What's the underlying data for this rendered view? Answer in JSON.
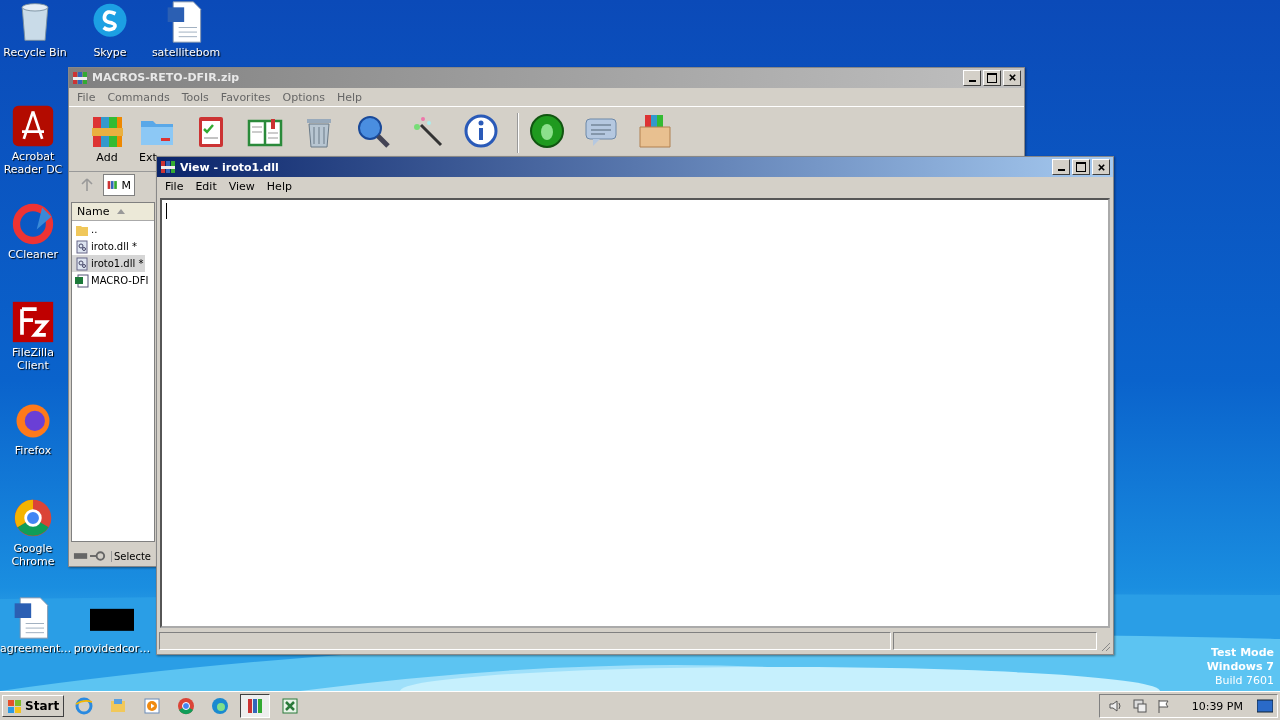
{
  "desktop_icons": [
    {
      "label": "Recycle Bin",
      "kind": "recycle"
    },
    {
      "label": "Skype",
      "kind": "skype"
    },
    {
      "label": "satellitebom",
      "kind": "word"
    },
    {
      "label": "Acrobat Reader DC",
      "kind": "acrobat"
    },
    {
      "label": "CCleaner",
      "kind": "ccleaner"
    },
    {
      "label": "FileZilla Client",
      "kind": "filezilla"
    },
    {
      "label": "Firefox",
      "kind": "firefox"
    },
    {
      "label": "Google Chrome",
      "kind": "chrome"
    },
    {
      "label": "agreement…",
      "kind": "word"
    },
    {
      "label": "providedcor…",
      "kind": "black"
    }
  ],
  "archiver": {
    "title": "MACROS-RETO-DFIR.zip",
    "menu": [
      "File",
      "Commands",
      "Tools",
      "Favorites",
      "Options",
      "Help"
    ],
    "toolbar": [
      {
        "kind": "add",
        "label": "Add"
      },
      {
        "kind": "extract",
        "label": "Ext"
      },
      {
        "kind": "test"
      },
      {
        "kind": "view"
      },
      {
        "kind": "delete"
      },
      {
        "kind": "find"
      },
      {
        "kind": "wizard"
      },
      {
        "kind": "info"
      },
      {
        "kind": "scan"
      },
      {
        "kind": "comment"
      },
      {
        "kind": "sfx"
      }
    ],
    "path": "M",
    "column": "Name",
    "files": [
      {
        "name": "..",
        "kind": "folder",
        "selected": false
      },
      {
        "name": "iroto.dll *",
        "kind": "dll",
        "selected": false
      },
      {
        "name": "iroto1.dll *",
        "kind": "dll",
        "selected": true
      },
      {
        "name": "MACRO-DFI",
        "kind": "excel",
        "selected": false
      }
    ],
    "status": "Selecte"
  },
  "viewer": {
    "title": "View - iroto1.dll",
    "menu": [
      "File",
      "Edit",
      "View",
      "Help"
    ]
  },
  "taskbar": {
    "start": "Start",
    "apps": [
      {
        "kind": "ie",
        "selected": false
      },
      {
        "kind": "explorer",
        "selected": false
      },
      {
        "kind": "media",
        "selected": false
      },
      {
        "kind": "chrome",
        "selected": false
      },
      {
        "kind": "edge",
        "selected": false
      },
      {
        "kind": "winrar",
        "selected": true
      },
      {
        "kind": "excel",
        "selected": false
      }
    ],
    "clock": "10:39 PM"
  },
  "os_notice": [
    "Test Mode",
    "Windows 7",
    "Build 7601"
  ]
}
